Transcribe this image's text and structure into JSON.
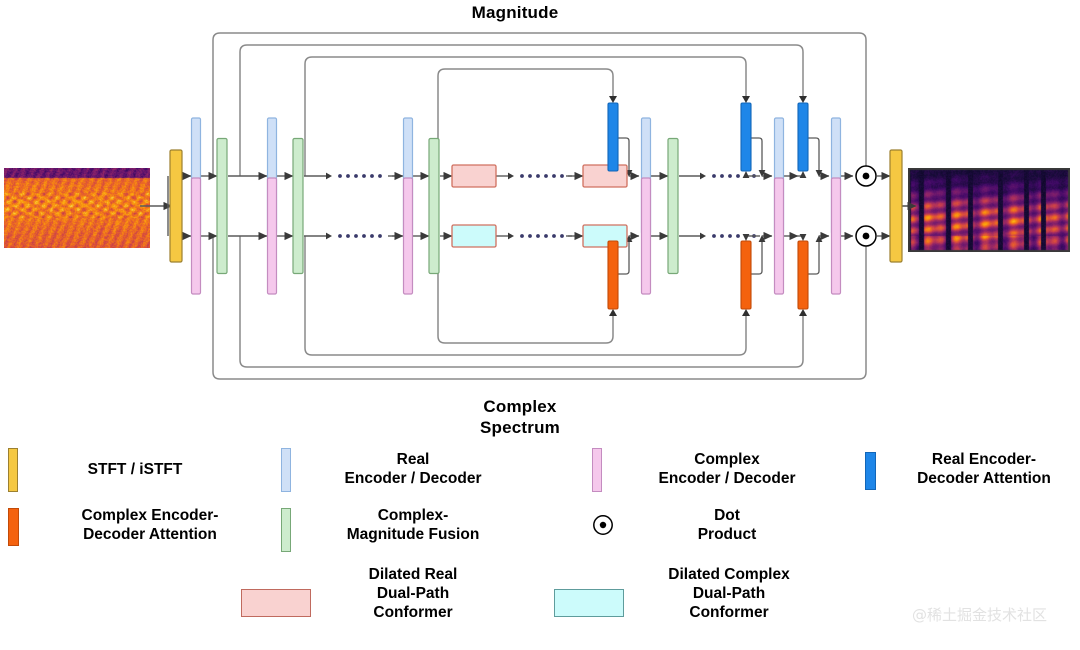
{
  "figure": {
    "type": "diagram",
    "subject": "Dual-path real/complex speech enhancement network architecture",
    "top_label": "Magnitude",
    "bottom_label": "Complex\nSpectrum",
    "watermark": "@稀土掘金技术社区"
  },
  "colors": {
    "stft_fill": "#f5c842",
    "stft_stroke": "#9c8030",
    "real_encoder_fill": "#cfe0f7",
    "real_encoder_stroke": "#8fb4e0",
    "complex_encoder_fill": "#f5c8ec",
    "complex_encoder_stroke": "#c48cc0",
    "fusion_fill": "#cdeccd",
    "fusion_stroke": "#77a877",
    "real_attention_fill": "#1e86e8",
    "real_attention_stroke": "#1266b8",
    "complex_attention_fill": "#f4620e",
    "complex_attention_stroke": "#c24a08",
    "dilated_real_fill": "#f9d2d0",
    "dilated_real_stroke": "#d0705f",
    "dilated_complex_fill": "#ccfbfb",
    "dilated_complex_stroke": "#d0705f",
    "line": "#5a5a5a",
    "skip_line": "#8a8a8a",
    "text": "#000000",
    "watermark": "#e2e2e2"
  },
  "pipeline": {
    "input_name": "noisy-spectrogram",
    "output_name": "enhanced-spectrogram",
    "magnitude_path": [
      {
        "kind": "stft",
        "label": "STFT"
      },
      {
        "kind": "real-encoder"
      },
      {
        "kind": "fusion"
      },
      {
        "kind": "real-encoder"
      },
      {
        "kind": "fusion"
      },
      {
        "kind": "ellipsis"
      },
      {
        "kind": "real-encoder"
      },
      {
        "kind": "fusion"
      },
      {
        "kind": "dilated-real-conformer"
      },
      {
        "kind": "ellipsis"
      },
      {
        "kind": "dilated-real-conformer"
      },
      {
        "kind": "real-attention"
      },
      {
        "kind": "real-decoder"
      },
      {
        "kind": "fusion"
      },
      {
        "kind": "real-attention"
      },
      {
        "kind": "real-decoder"
      },
      {
        "kind": "ellipsis"
      },
      {
        "kind": "real-attention"
      },
      {
        "kind": "real-decoder"
      },
      {
        "kind": "fusion"
      },
      {
        "kind": "real-attention"
      },
      {
        "kind": "real-decoder"
      },
      {
        "kind": "dot-product"
      },
      {
        "kind": "istft",
        "label": "iSTFT"
      }
    ],
    "complex_path": [
      {
        "kind": "complex-encoder"
      },
      {
        "kind": "fusion"
      },
      {
        "kind": "complex-encoder"
      },
      {
        "kind": "fusion"
      },
      {
        "kind": "ellipsis"
      },
      {
        "kind": "complex-encoder"
      },
      {
        "kind": "fusion"
      },
      {
        "kind": "dilated-complex-conformer"
      },
      {
        "kind": "ellipsis"
      },
      {
        "kind": "dilated-complex-conformer"
      },
      {
        "kind": "complex-attention"
      },
      {
        "kind": "complex-decoder"
      },
      {
        "kind": "complex-attention"
      },
      {
        "kind": "complex-decoder"
      },
      {
        "kind": "dot-product"
      }
    ],
    "skip_connection_count": 4
  },
  "legend": {
    "items": [
      {
        "id": "stft-istft",
        "swatch": "bar",
        "color": "#f5c842",
        "stroke": "#9c8030",
        "label": "STFT / iSTFT"
      },
      {
        "id": "real-encoder-decoder",
        "swatch": "bar",
        "color": "#cfe0f7",
        "stroke": "#8fb4e0",
        "label": "Real\nEncoder / Decoder"
      },
      {
        "id": "complex-encoder-decoder",
        "swatch": "bar",
        "color": "#f5c8ec",
        "stroke": "#c48cc0",
        "label": "Complex\nEncoder / Decoder"
      },
      {
        "id": "real-encoder-decoder-attention",
        "swatch": "bar",
        "color": "#1e86e8",
        "stroke": "#1266b8",
        "label": "Real Encoder-\nDecoder Attention"
      },
      {
        "id": "complex-encoder-decoder-attention",
        "swatch": "bar",
        "color": "#f4620e",
        "stroke": "#c24a08",
        "label": "Complex Encoder-\nDecoder Attention"
      },
      {
        "id": "complex-magnitude-fusion",
        "swatch": "bar",
        "color": "#cdeccd",
        "stroke": "#77a877",
        "label": "Complex-\nMagnitude Fusion"
      },
      {
        "id": "dot-product",
        "swatch": "circle",
        "color": "#ffffff",
        "stroke": "#000000",
        "label": "Dot\nProduct"
      },
      {
        "id": "dilated-real-conformer",
        "swatch": "box",
        "color": "#f9d2d0",
        "stroke": "#c06a5e",
        "label": "Dilated Real\nDual-Path\nConformer"
      },
      {
        "id": "dilated-complex-conformer",
        "swatch": "box",
        "color": "#ccfbfb",
        "stroke": "#5e9c9c",
        "label": "Dilated Complex\nDual-Path\nConformer"
      }
    ]
  }
}
